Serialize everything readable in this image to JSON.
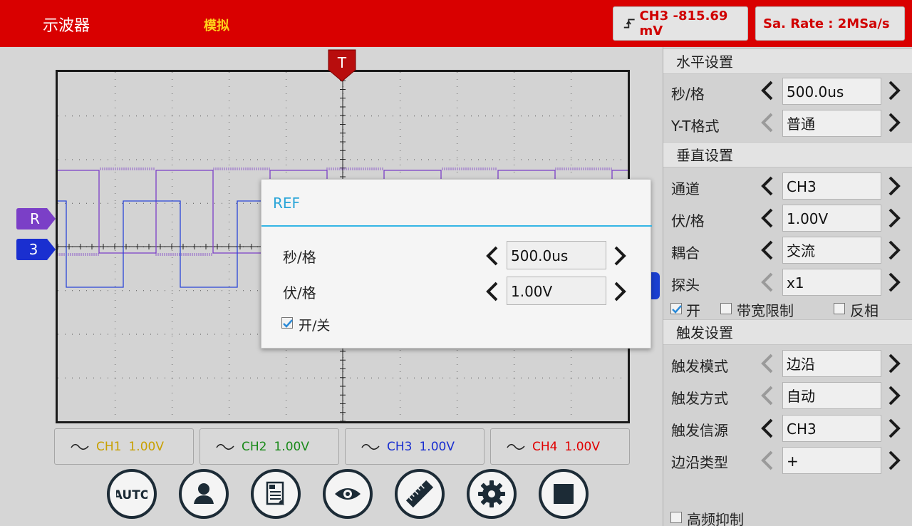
{
  "topbar": {
    "title": "示波器",
    "mode": "模拟",
    "trigger_readout": "CH3 -815.69 mV",
    "sample_rate": "Sa. Rate : 2MSa/s"
  },
  "markers": {
    "trigger": "T",
    "ref": "R",
    "channel": "3"
  },
  "channels": [
    {
      "name": "CH1",
      "scale": "1.00V",
      "color": "#c8a000"
    },
    {
      "name": "CH2",
      "scale": "1.00V",
      "color": "#1a8a1a"
    },
    {
      "name": "CH3",
      "scale": "1.00V",
      "color": "#1a2fd0"
    },
    {
      "name": "CH4",
      "scale": "1.00V",
      "color": "#e00000"
    }
  ],
  "waveform_colors": {
    "ref": "#7b3fc7",
    "ch3": "#2a44d8"
  },
  "toolbar": [
    "auto-icon",
    "user-icon",
    "document-icon",
    "eye-icon",
    "ruler-icon",
    "gear-icon",
    "stop-icon"
  ],
  "toolbar_auto_label": "AUTO",
  "panel": {
    "horizontal": {
      "title": "水平设置",
      "rows": [
        {
          "label": "秒/格",
          "value": "500.0us",
          "left_enabled": true
        },
        {
          "label": "Y-T格式",
          "value": "普通",
          "left_enabled": false
        }
      ]
    },
    "vertical": {
      "title": "垂直设置",
      "rows": [
        {
          "label": "通道",
          "value": "CH3",
          "left_enabled": true
        },
        {
          "label": "伏/格",
          "value": "1.00V",
          "left_enabled": true
        },
        {
          "label": "耦合",
          "value": "交流",
          "left_enabled": true
        },
        {
          "label": "探头",
          "value": "x1",
          "left_enabled": false
        }
      ],
      "checks": [
        {
          "label": "开",
          "checked": true
        },
        {
          "label": "带宽限制",
          "checked": false
        },
        {
          "label": "反相",
          "checked": false
        }
      ]
    },
    "trigger": {
      "title": "触发设置",
      "rows": [
        {
          "label": "触发模式",
          "value": "边沿",
          "left_enabled": false
        },
        {
          "label": "触发方式",
          "value": "自动",
          "left_enabled": false
        },
        {
          "label": "触发信源",
          "value": "CH3",
          "left_enabled": true
        },
        {
          "label": "边沿类型",
          "value": "+",
          "left_enabled": false
        }
      ],
      "hf_reject": {
        "label": "高频抑制",
        "checked": false
      }
    }
  },
  "dialog": {
    "title": "REF",
    "rows": [
      {
        "label": "秒/格",
        "value": "500.0us"
      },
      {
        "label": "伏/格",
        "value": "1.00V"
      }
    ],
    "enable": {
      "label": "开/关",
      "checked": true
    }
  }
}
